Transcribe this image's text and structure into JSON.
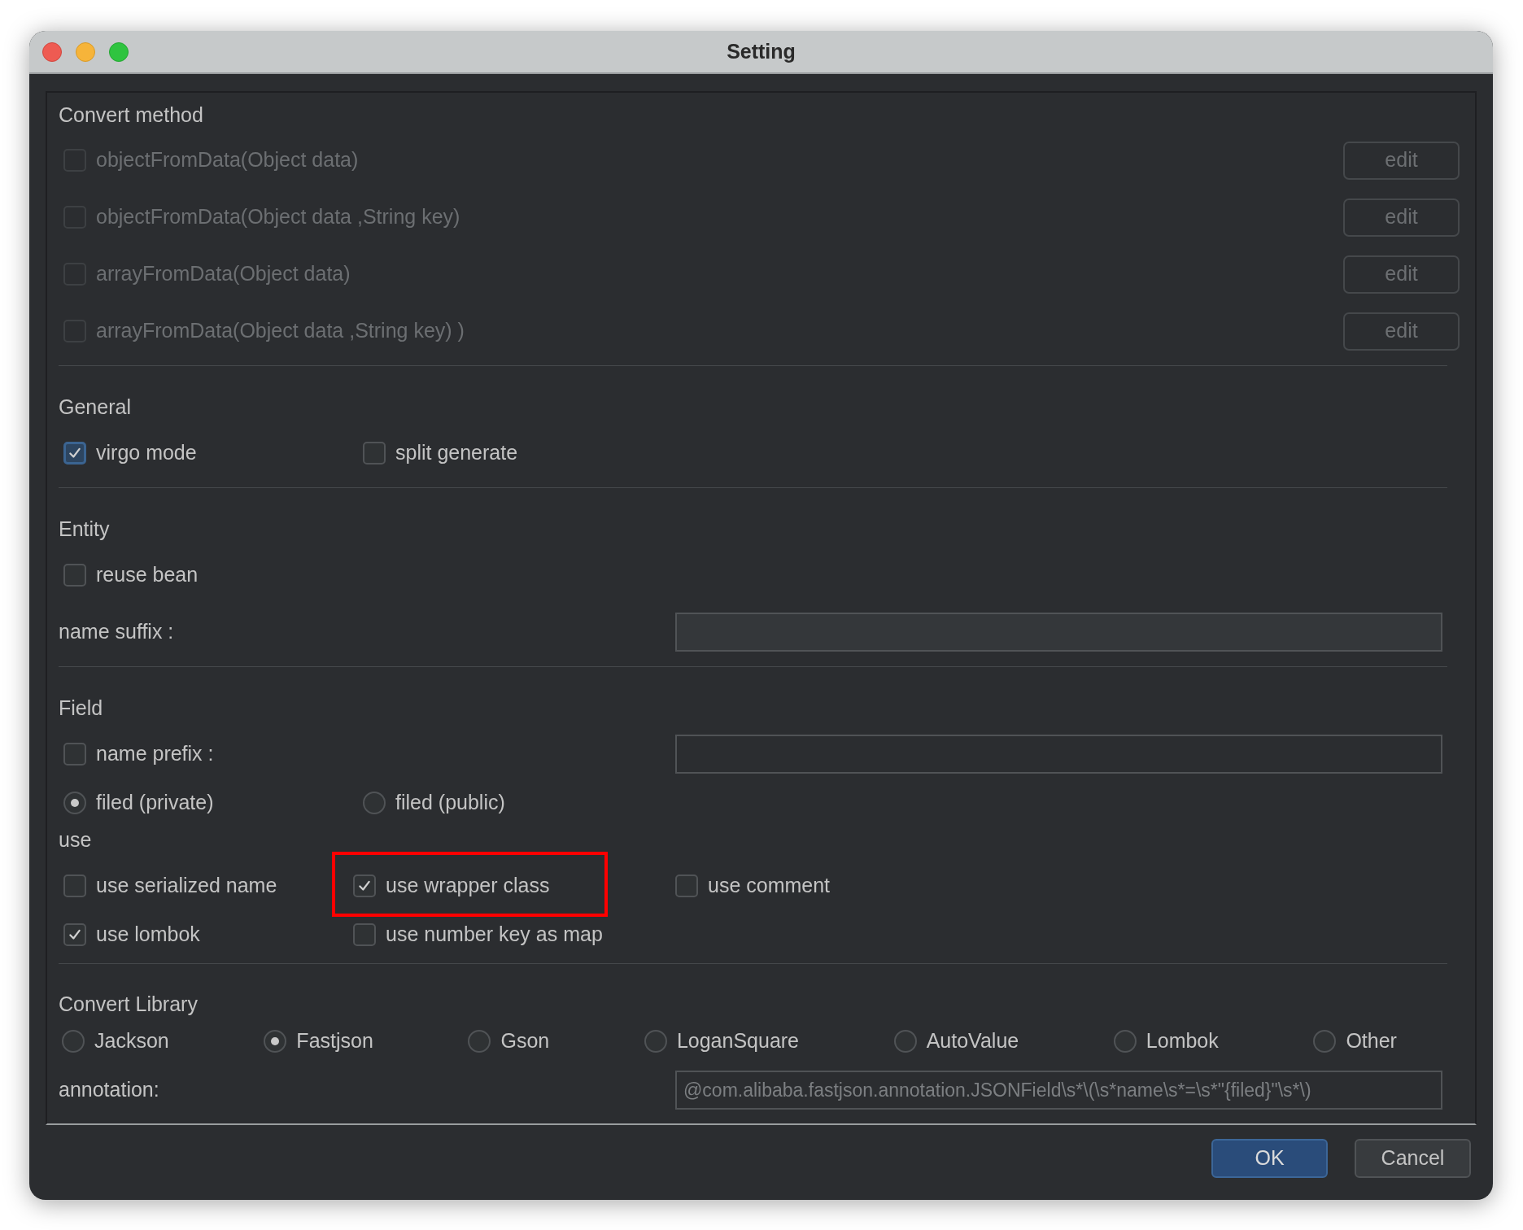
{
  "window": {
    "title": "Setting"
  },
  "convert_method": {
    "heading": "Convert method",
    "items": [
      {
        "label": "objectFromData(Object data)",
        "checked": false,
        "disabled": true,
        "button": "edit"
      },
      {
        "label": "objectFromData(Object data ,String key)",
        "checked": false,
        "disabled": true,
        "button": "edit"
      },
      {
        "label": "arrayFromData(Object data)",
        "checked": false,
        "disabled": true,
        "button": "edit"
      },
      {
        "label": "arrayFromData(Object data ,String key) )",
        "checked": false,
        "disabled": true,
        "button": "edit"
      }
    ]
  },
  "general": {
    "heading": "General",
    "options": [
      {
        "label": "virgo mode",
        "checked": true,
        "focused": true
      },
      {
        "label": "split generate",
        "checked": false,
        "focused": false
      }
    ]
  },
  "entity": {
    "heading": "Entity",
    "options": [
      {
        "label": "reuse bean",
        "checked": false
      }
    ],
    "name_suffix": {
      "label": "name suffix :"
    }
  },
  "field": {
    "heading": "Field",
    "name_prefix": {
      "label": "name prefix :",
      "checked": false
    },
    "visibility": [
      {
        "label": "filed (private)",
        "selected": true
      },
      {
        "label": "filed (public)",
        "selected": false
      }
    ],
    "use_heading": "use",
    "use_rows": [
      {
        "options": [
          {
            "label": "use serialized name",
            "checked": false,
            "highlighted": false
          },
          {
            "label": "use wrapper class",
            "checked": true,
            "highlighted": true
          },
          {
            "label": "use comment",
            "checked": false,
            "highlighted": false
          }
        ]
      },
      {
        "options": [
          {
            "label": "use lombok",
            "checked": true,
            "highlighted": false
          },
          {
            "label": "use number key as map",
            "checked": false,
            "highlighted": false
          }
        ]
      }
    ]
  },
  "convert_library": {
    "heading": "Convert Library",
    "options": [
      {
        "label": "Jackson",
        "selected": false
      },
      {
        "label": "Fastjson",
        "selected": true
      },
      {
        "label": "Gson",
        "selected": false
      },
      {
        "label": "LoganSquare",
        "selected": false
      },
      {
        "label": "AutoValue",
        "selected": false
      },
      {
        "label": "Lombok",
        "selected": false
      },
      {
        "label": "Other",
        "selected": false
      }
    ],
    "annotation": {
      "label": "annotation:",
      "value": "@com.alibaba.fastjson.annotation.JSONField\\s*\\(\\s*name\\s*=\\s*\"{filed}\"\\s*\\)"
    }
  },
  "buttons": [
    {
      "label": "OK",
      "primary": true
    },
    {
      "label": "Cancel",
      "primary": false
    }
  ]
}
